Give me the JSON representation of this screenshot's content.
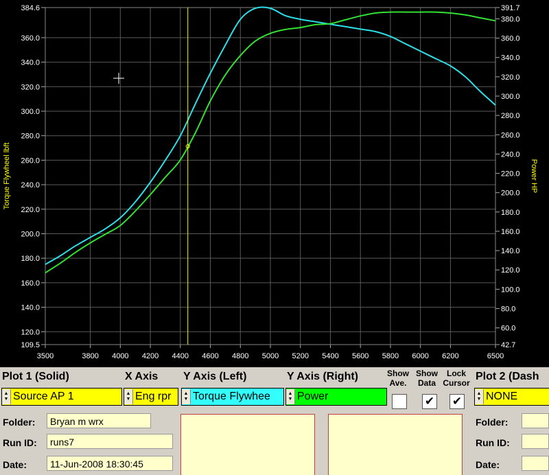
{
  "colors": {
    "torque": "#2ce0e8",
    "power": "#33e033",
    "cursor": "#ffff00",
    "axis_text_left": "#ffffff",
    "axis_label": "#ffff00",
    "grid": "#5a5a5a",
    "background": "#000000",
    "yellow_field": "#ffff00",
    "cyan_field": "#33ffff",
    "green_field": "#00ff00"
  },
  "chart_data": {
    "type": "line",
    "xlabel": "",
    "ylabel": "Torque Flywheel lbft",
    "ylabel_right": "Power HP",
    "xlim": [
      3500,
      6500
    ],
    "ylim": [
      109.5,
      384.6
    ],
    "ylim_right": [
      42.7,
      391.7
    ],
    "grid": true,
    "x_ticks": [
      "3500",
      "3800",
      "4000",
      "4200",
      "4400",
      "4600",
      "4800",
      "5000",
      "5200",
      "5400",
      "5600",
      "5800",
      "6000",
      "6200",
      "6500"
    ],
    "y_ticks_left": [
      "384.6",
      "360.0",
      "340.0",
      "320.0",
      "300.0",
      "280.0",
      "260.0",
      "240.0",
      "220.0",
      "200.0",
      "180.0",
      "160.0",
      "140.0",
      "120.0",
      "109.5"
    ],
    "y_ticks_right": [
      "391.7",
      "380.0",
      "360.0",
      "340.0",
      "320.0",
      "300.0",
      "280.0",
      "260.0",
      "240.0",
      "220.0",
      "200.0",
      "180.0",
      "160.0",
      "140.0",
      "120.0",
      "100.0",
      "80.0",
      "60.0",
      "42.7"
    ],
    "cursor_x": 4450,
    "series": [
      {
        "name": "Torque Flywheel",
        "axis": "left",
        "x": [
          3500,
          3600,
          3700,
          3800,
          3900,
          4000,
          4100,
          4200,
          4300,
          4400,
          4500,
          4600,
          4700,
          4800,
          4900,
          5000,
          5100,
          5200,
          5300,
          5400,
          5500,
          5600,
          5700,
          5800,
          5900,
          6000,
          6100,
          6200,
          6300,
          6400,
          6500
        ],
        "y": [
          175,
          182,
          190,
          197,
          204,
          213,
          226,
          242,
          260,
          280,
          306,
          331,
          354,
          375,
          384,
          384,
          378,
          375,
          373,
          371,
          369,
          367,
          365,
          361,
          355,
          349,
          343,
          337,
          328,
          316,
          305
        ]
      },
      {
        "name": "Power",
        "axis": "right",
        "x": [
          3500,
          3600,
          3700,
          3800,
          3900,
          4000,
          4100,
          4200,
          4300,
          4400,
          4500,
          4600,
          4700,
          4800,
          4900,
          5000,
          5100,
          5200,
          5300,
          5400,
          5500,
          5600,
          5700,
          5800,
          5900,
          6000,
          6100,
          6200,
          6300,
          6400,
          6500
        ],
        "y": [
          117,
          127,
          138,
          148,
          157,
          166,
          181,
          198,
          216,
          234,
          262,
          295,
          322,
          342,
          357,
          365,
          369,
          371,
          374,
          375,
          379,
          383,
          386,
          387,
          387,
          387,
          387,
          386,
          384,
          381,
          378
        ]
      }
    ]
  },
  "panel": {
    "plot1_title": "Plot 1 (Solid)",
    "xaxis_title": "X Axis",
    "yleft_title": "Y Axis (Left)",
    "yright_title": "Y Axis (Right)",
    "show_ave": "Show Ave.",
    "show_data": "Show Data",
    "lock_cursor": "Lock Cursor",
    "plot2_title": "Plot 2 (Dash",
    "source1": "Source AP 1",
    "xaxis_sel": "Eng rpr",
    "yleft_sel": "Torque Flywhee",
    "yright_sel": "Power",
    "source2": "NONE",
    "check_mark": "✔",
    "folder_label": "Folder:",
    "folder_value": "Bryan m wrx",
    "runid_label": "Run ID:",
    "runid_value": "runs7",
    "date_label": "Date:",
    "date_value": "11-Jun-2008  18:30:45",
    "folder_label2": "Folder:",
    "runid_label2": "Run ID:",
    "date_label2": "Date:"
  }
}
